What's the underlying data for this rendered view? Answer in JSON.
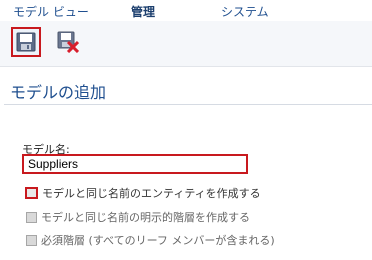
{
  "menu": {
    "items": [
      {
        "label": "モデル ビュー"
      },
      {
        "label": "管理"
      },
      {
        "label": "システム"
      }
    ]
  },
  "toolbar": {
    "save_icon": "save-icon",
    "cancel_icon": "cancel-save-icon"
  },
  "page": {
    "title": "モデルの追加"
  },
  "form": {
    "name_label": "モデル名:",
    "name_value": "Suppliers",
    "checkboxes": [
      {
        "label": "モデルと同じ名前のエンティティを作成する",
        "checked": false,
        "enabled": true
      },
      {
        "label": "モデルと同じ名前の明示的階層を作成する",
        "checked": false,
        "enabled": false
      },
      {
        "label": "必須階層 (すべてのリーフ メンバーが含まれる)",
        "checked": false,
        "enabled": false
      }
    ]
  },
  "colors": {
    "accent_blue": "#1f4f8f",
    "highlight_red": "#c8191e"
  }
}
